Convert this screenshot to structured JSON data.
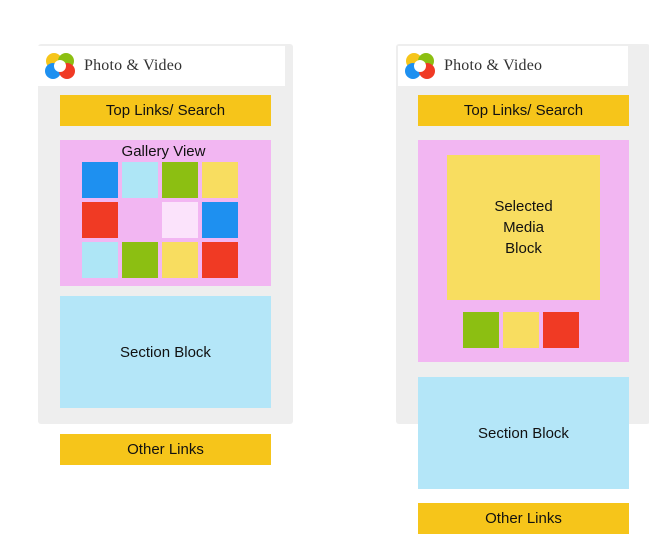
{
  "colors": {
    "frame": "#eeeeee",
    "bar": "#f6c51a",
    "gallery_bg": "#f2b6f2",
    "section": "#b4e6f8",
    "media": "#f8dd60",
    "blue": "#1e90f0",
    "light_blue": "#aee6f6",
    "green": "#8cbf12",
    "yellow": "#f8dd60",
    "red": "#f03a24",
    "pink": "#f2b6f2",
    "pale_pink": "#fbe3fb"
  },
  "left_mockup": {
    "app_title": "Photo & Video",
    "logo_icon": "photo-video-logo-icon",
    "top_bar_label": "Top Links/ Search",
    "gallery_label": "Gallery View",
    "gallery_tiles": [
      "blue",
      "light_blue",
      "green",
      "yellow",
      "red",
      "pink",
      "pale_pink",
      "blue",
      "light_blue",
      "green",
      "yellow",
      "red"
    ],
    "section_label": "Section Block",
    "bottom_bar_label": "Other Links"
  },
  "right_mockup": {
    "app_title": "Photo & Video",
    "logo_icon": "photo-video-logo-icon",
    "top_bar_label": "Top Links/ Search",
    "selected_media_label": "Selected\nMedia\nBlock",
    "thumbnails": [
      "green",
      "yellow",
      "red"
    ],
    "section_label": "Section Block",
    "bottom_bar_label": "Other Links"
  }
}
